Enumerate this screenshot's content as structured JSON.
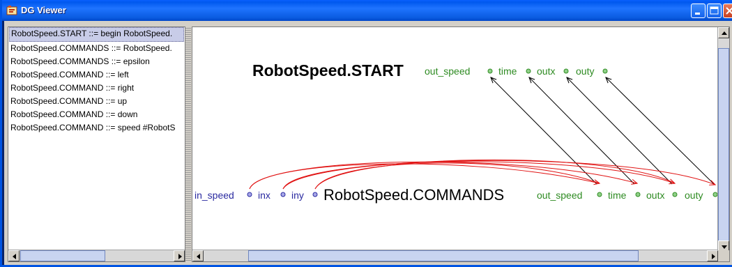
{
  "window": {
    "title": "DG Viewer",
    "icon": "dg-viewer-app-icon"
  },
  "rules": [
    {
      "label": "RobotSpeed.START ::= begin RobotSpeed.",
      "selected": true
    },
    {
      "label": "RobotSpeed.COMMANDS ::= RobotSpeed.",
      "selected": false
    },
    {
      "label": "RobotSpeed.COMMANDS ::= epsilon",
      "selected": false
    },
    {
      "label": "RobotSpeed.COMMAND ::= left",
      "selected": false
    },
    {
      "label": "RobotSpeed.COMMAND ::= right",
      "selected": false
    },
    {
      "label": "RobotSpeed.COMMAND ::= up",
      "selected": false
    },
    {
      "label": "RobotSpeed.COMMAND ::= down",
      "selected": false
    },
    {
      "label": "RobotSpeed.COMMAND ::= speed #RobotS",
      "selected": false
    }
  ],
  "graph": {
    "top_node": {
      "name": "RobotSpeed.START",
      "synthesized": [
        "out_speed",
        "time",
        "outx",
        "outy"
      ]
    },
    "bottom_node": {
      "name": "RobotSpeed.COMMANDS",
      "inherited": [
        "in_speed",
        "inx",
        "iny"
      ],
      "synthesized": [
        "out_speed",
        "time",
        "outx",
        "outy"
      ]
    },
    "colors": {
      "synthesized": "#2e8b22",
      "inherited": "#2a2aa0",
      "dependency": "#e01010",
      "edge": "#000000",
      "node_name": "#000000"
    }
  }
}
